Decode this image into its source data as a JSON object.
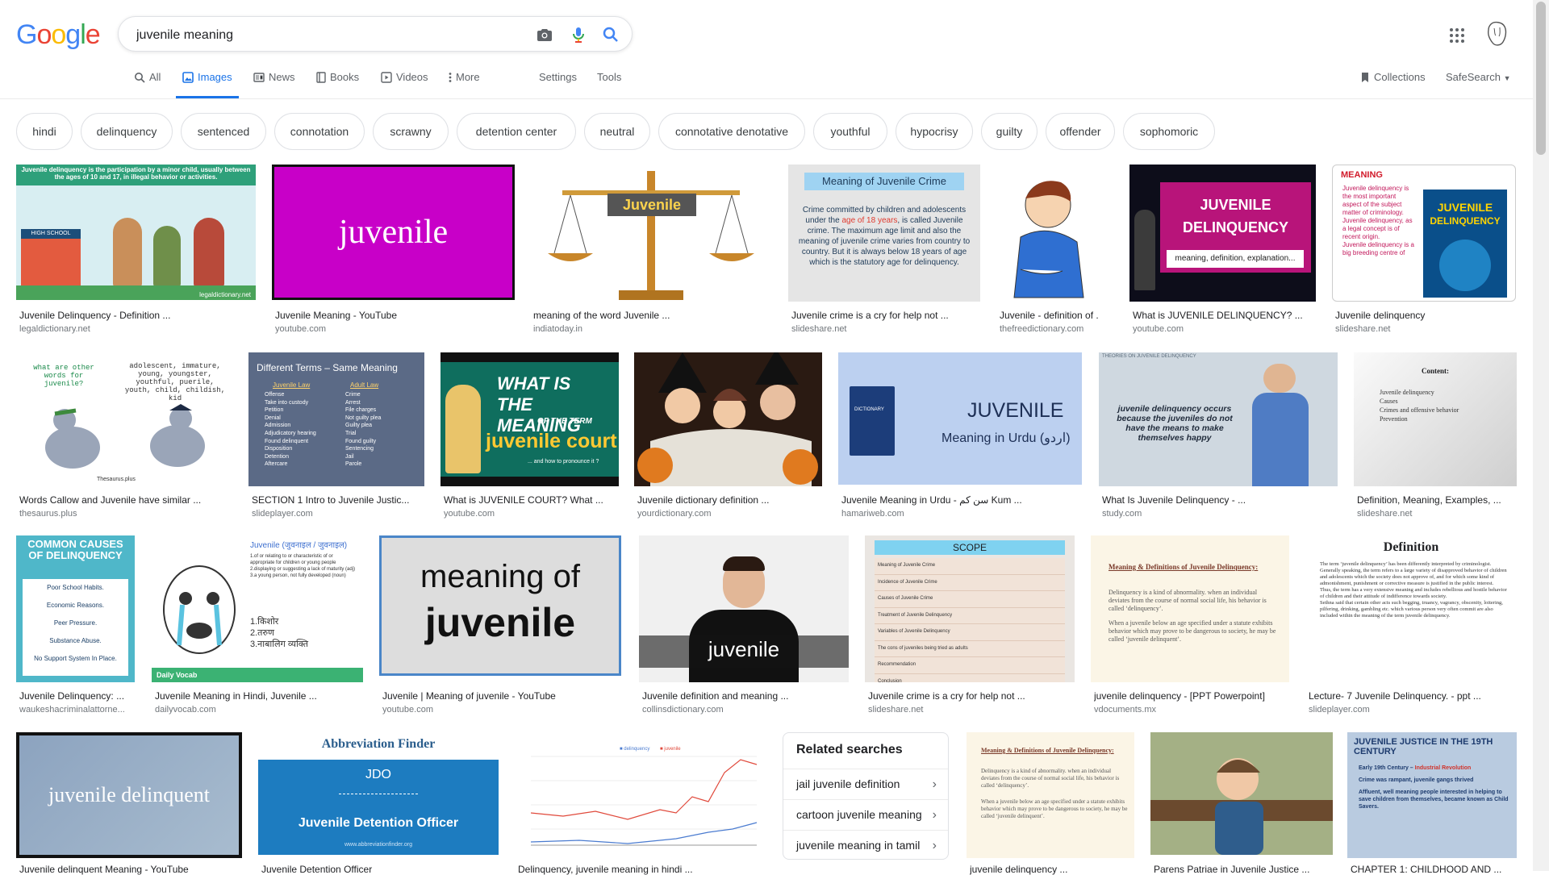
{
  "logo": [
    "G",
    "o",
    "o",
    "g",
    "l",
    "e"
  ],
  "logo_colors": [
    "#4285f4",
    "#ea4335",
    "#fbbc05",
    "#4285f4",
    "#34a853",
    "#ea4335"
  ],
  "search": {
    "query": "juvenile meaning"
  },
  "nav": {
    "tabs": [
      {
        "label": "All",
        "icon": "search-icon"
      },
      {
        "label": "Images",
        "icon": "image-icon"
      },
      {
        "label": "News",
        "icon": "news-icon"
      },
      {
        "label": "Books",
        "icon": "book-icon"
      },
      {
        "label": "Videos",
        "icon": "video-icon"
      },
      {
        "label": "More",
        "icon": "more-icon"
      }
    ],
    "settings": "Settings",
    "tools": "Tools",
    "collections": "Collections",
    "safesearch": "SafeSearch"
  },
  "chips": [
    "hindi",
    "delinquency",
    "sentenced",
    "connotation",
    "scrawny",
    "detention center",
    "neutral",
    "connotative denotative",
    "youthful",
    "hypocrisy",
    "guilty",
    "offender",
    "sophomoric"
  ],
  "results": {
    "row1": [
      {
        "caption": "Juvenile Delinquency - Definition ...",
        "source": "legaldictionary.net",
        "text": "Juvenile delinquency is the participation by a minor child, usually between the ages of 10 and 17, in illegal behavior or activities.",
        "sub": "HIGH SCHOOL",
        "credit": "legaldictionary.net"
      },
      {
        "caption": "Juvenile Meaning - YouTube",
        "source": "youtube.com",
        "text": "juvenile"
      },
      {
        "caption": "meaning of the word Juvenile ...",
        "source": "indiatoday.in",
        "text": "Juvenile"
      },
      {
        "caption": "Juvenile crime is a cry for help not ...",
        "source": "slideshare.net",
        "title": "Meaning of Juvenile Crime",
        "text_a": "Crime committed by children and adolescents under the ",
        "text_b": "age of 18 years",
        "text_c": ", is called Juvenile crime. The maximum age limit and also the meaning of juvenile crime varies from country to country. But it is always below 18 years of age which is the statutory age for delinquency."
      },
      {
        "caption": "Juvenile - definition of ...",
        "source": "thefreedictionary.com"
      },
      {
        "caption": "What is JUVENILE DELINQUENCY? ...",
        "source": "youtube.com",
        "line1": "JUVENILE",
        "line2": "DELINQUENCY",
        "line3": "meaning, definition, explanation..."
      },
      {
        "caption": "Juvenile delinquency",
        "source": "slideshare.net",
        "title": "MEANING",
        "bullets": [
          "Juvenile delinquency is the most important aspect of the subject matter of criminology.",
          "Juvenile delinquency, as a legal concept is of recent origin.",
          "Juvenile delinquency is a big breeding centre of"
        ],
        "book_l1": "JUVENILE",
        "book_l2": "DELINQUENCY"
      }
    ],
    "row2": [
      {
        "caption": "Words Callow and Juvenile have similar ...",
        "source": "thesaurus.plus",
        "q": "what are other words for juvenile?",
        "a": "adolescent, immature, young, youngster, youthful, puerile, youth, child, childish, kid",
        "credit": "Thesaurus.plus"
      },
      {
        "caption": "SECTION 1 Intro to Juvenile Justic...",
        "source": "slideplayer.com",
        "title": "Different Terms – Same Meaning",
        "col1": "Juvenile Law",
        "col2": "Adult Law",
        "left": [
          "Offense",
          "Take into custody",
          "Petition",
          "Denial",
          "Admission",
          "Adjudicatory hearing",
          "Found delinquent",
          "Disposition",
          "Detention",
          "Aftercare"
        ],
        "right": [
          "Crime",
          "Arrest",
          "File charges",
          "Not guilty plea",
          "Guilty plea",
          "Trial",
          "Found guilty",
          "Sentencing",
          "Jail",
          "Parole"
        ]
      },
      {
        "caption": "What is JUVENILE COURT? What ...",
        "source": "youtube.com",
        "l1": "WHAT IS",
        "l2": "THE MEANING",
        "l3": "OF THE TERM",
        "l4": "juvenile court",
        "l5": "... and how to pronounce it ?"
      },
      {
        "caption": "Juvenile dictionary definition ...",
        "source": "yourdictionary.com"
      },
      {
        "caption": "Juvenile Meaning in Urdu - سن کم Kum ...",
        "source": "hamariweb.com",
        "l1": "JUVENILE",
        "l2": "Meaning in Urdu (اردو)",
        "book": "DICTIONARY"
      },
      {
        "caption": "What Is Juvenile Delinquency - ...",
        "source": "study.com",
        "text": "juvenile delinquency occurs because the juveniles do not have the means to make themselves happy",
        "header": "THEORIES ON JUVENILE DELINQUENCY"
      },
      {
        "caption": "Definition, Meaning, Examples, ...",
        "source": "slideshare.net",
        "title": "Content:",
        "items": [
          "Juvenile delinquency",
          "Causes",
          "Crimes and offensive behavior",
          "Prevention"
        ]
      }
    ],
    "row3": [
      {
        "caption": "Juvenile Delinquency: ...",
        "source": "waukeshacriminalattorne...",
        "title": "COMMON CAUSES OF DELINQUENCY",
        "items": [
          "Poor School Habits.",
          "Economic Reasons.",
          "Peer Pressure.",
          "Substance Abuse.",
          "No Support System In Place."
        ]
      },
      {
        "caption": "Juvenile Meaning in Hindi, Juvenile ...",
        "source": "dailyvocab.com",
        "title": "Juvenile (जुवनाइल / जुवनाइल)",
        "defs": [
          "1.of or relating to or characteristic of or appropriate for children or young people",
          "2.displaying or suggesting a lack of maturity (adj)",
          "3.a young person, not fully developed (noun)"
        ],
        "hindi": [
          "1.किशोर",
          "2.तरुण",
          "3.नाबालिग व्यक्ति"
        ],
        "brand": "Daily Vocab"
      },
      {
        "caption": "Juvenile | Meaning of juvenile - YouTube",
        "source": "youtube.com",
        "l1": "meaning of",
        "l2": "juvenile"
      },
      {
        "caption": "Juvenile definition and meaning ...",
        "source": "collinsdictionary.com",
        "text": "juvenile"
      },
      {
        "caption": "Juvenile crime is a cry for help not ...",
        "source": "slideshare.net",
        "title": "SCOPE",
        "items": [
          "Meaning of Juvenile Crime",
          "Incidence of Juvenile Crime",
          "Causes of Juvenile Crime",
          "Treatment of Juvenile Delinquency",
          "Variables of Juvenile Delinquency",
          "The cons of juveniles being tried as adults",
          "Recommendation",
          "Conclusion"
        ]
      },
      {
        "caption": "juvenile delinquency - [PPT Powerpoint]",
        "source": "vdocuments.mx",
        "title": "Meaning & Definitions of Juvenile Delinquency:",
        "p1": "Delinquency is a kind of abnormality. when an individual deviates from the course of normal social life, his behavior is called ‘delinquency’.",
        "p2": "When a juvenile below an age specified under a statute exhibits behavior which may prove to be dangerous to society, he may be called ‘juvenile delinquent’."
      },
      {
        "caption": "Lecture- 7 Juvenile Delinquency. - ppt ...",
        "source": "slideplayer.com",
        "title": "Definition",
        "bullets": [
          "The term ‘juvenile delinquency’ has been differently interpreted by criminologist.",
          "Generally speaking, the term refers to a large variety of disapproved behavior of children and adolescents which the society does not approve of, and for which some kind of admonishment, punishment or corrective measure is justified in the public interest.",
          "Thus, the term has a very extensive meaning and includes rebellious and hostile behavior of children and their attitude of indifference towards society.",
          "Sethna said that certain other acts such begging, truancy, vagrancy, obscenity, loitering, pilfering, drinking, gambling etc. which various person very often commit are also included within the meaning of the term juvenile delinquency."
        ]
      }
    ],
    "row4": [
      {
        "caption": "Juvenile delinquent Meaning - YouTube",
        "text": "juvenile delinquent"
      },
      {
        "caption": "Juvenile Detention Officer",
        "brand": "Abbreviation Finder",
        "abbr": "JDO",
        "full": "Juvenile Detention Officer",
        "url": "www.abbreviationfinder.org"
      },
      {
        "caption": "Delinquency, juvenile meaning in hindi ...",
        "legend": [
          "delinquency",
          "juvenile"
        ]
      },
      {
        "caption": "juvenile delinquency ...",
        "title": "Meaning & Definitions of Juvenile Delinquency:",
        "p1": "Delinquency is a kind of abnormality. when an individual deviates from the course of normal social life, his behavior is called ‘delinquency’.",
        "p2": "When a juvenile below an age specified under a statute exhibits behavior which may prove to be dangerous to society, he may be called ‘juvenile delinquent’."
      },
      {
        "caption": "Parens Patriae in Juvenile Justice ..."
      },
      {
        "caption": "CHAPTER 1: CHILDHOOD AND ...",
        "title": "JUVENILE JUSTICE IN THE 19TH CENTURY",
        "b1a": "Early 19th Century – ",
        "b1b": "Industrial Revolution",
        "b2": "Crime was rampant, juvenile gangs thrived",
        "b3": "Affluent, well meaning people interested in helping to save children from themselves, became known as Child Savers."
      }
    ]
  },
  "related": {
    "title": "Related searches",
    "items": [
      "jail juvenile definition",
      "cartoon juvenile meaning",
      "juvenile meaning in tamil"
    ]
  }
}
